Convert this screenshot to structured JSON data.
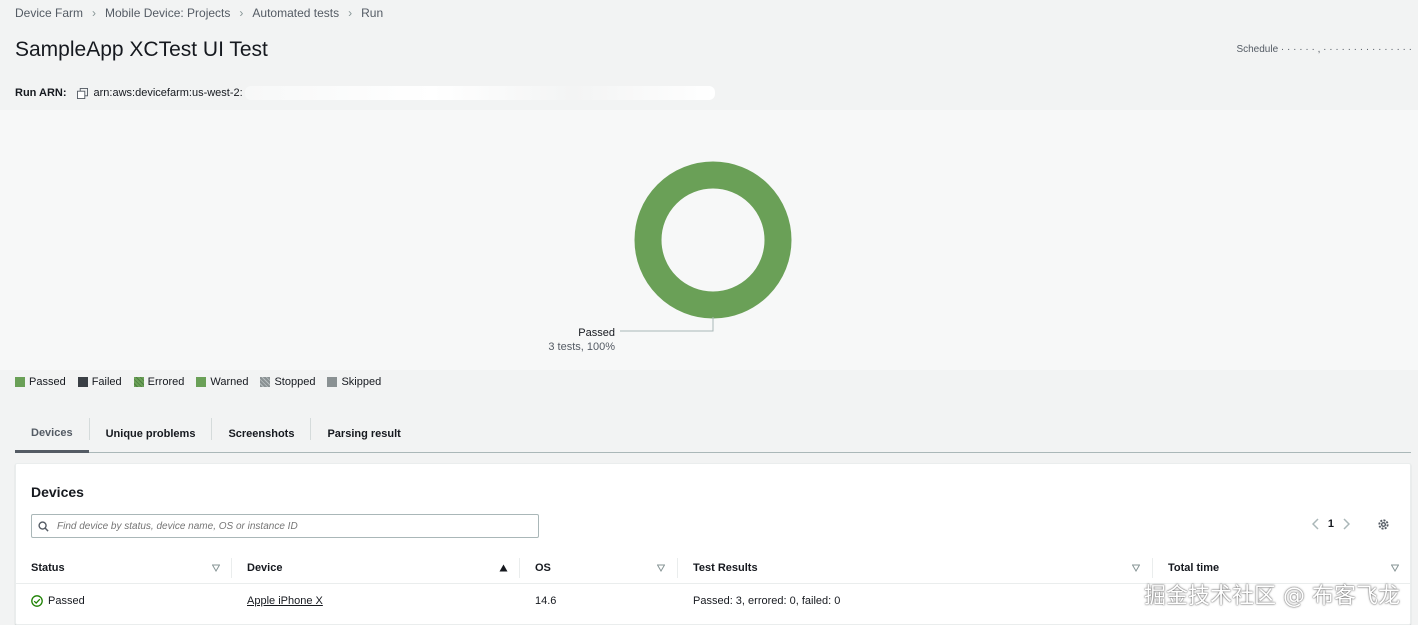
{
  "breadcrumb": [
    "Device Farm",
    "Mobile Device: Projects",
    "Automated tests",
    "Run"
  ],
  "page_title": "SampleApp XCTest UI Test",
  "schedule_text": "Schedule  ·  · · ·  · · ,  ·  · · · · ·  · · · · · · ·  · ·",
  "run_arn": {
    "label": "Run ARN:",
    "value": "arn:aws:devicefarm:us-west-2:"
  },
  "donut": {
    "label": "Passed",
    "sub": "3 tests, 100%",
    "color": "#6aa057"
  },
  "legend": [
    {
      "label": "Passed",
      "color": "#6aa057"
    },
    {
      "label": "Failed",
      "color": "#3a3f45"
    },
    {
      "label": "Errored",
      "color": "#6aa057"
    },
    {
      "label": "Warned",
      "color": "#6aa057"
    },
    {
      "label": "Stopped",
      "color": "#8a9193"
    },
    {
      "label": "Skipped",
      "color": "#8a9193"
    }
  ],
  "tabs": [
    "Devices",
    "Unique problems",
    "Screenshots",
    "Parsing result"
  ],
  "devices": {
    "title": "Devices",
    "search_placeholder": "Find device by status, device name, OS or instance ID",
    "page": "1",
    "columns": [
      "Status",
      "Device",
      "OS",
      "Test Results",
      "Total time"
    ],
    "rows": [
      {
        "status": "Passed",
        "device": "Apple iPhone X",
        "os": "14.6",
        "results": "Passed: 3, errored: 0, failed: 0",
        "time": ""
      }
    ]
  },
  "watermark": "掘金技术社区 @ 布客飞龙"
}
